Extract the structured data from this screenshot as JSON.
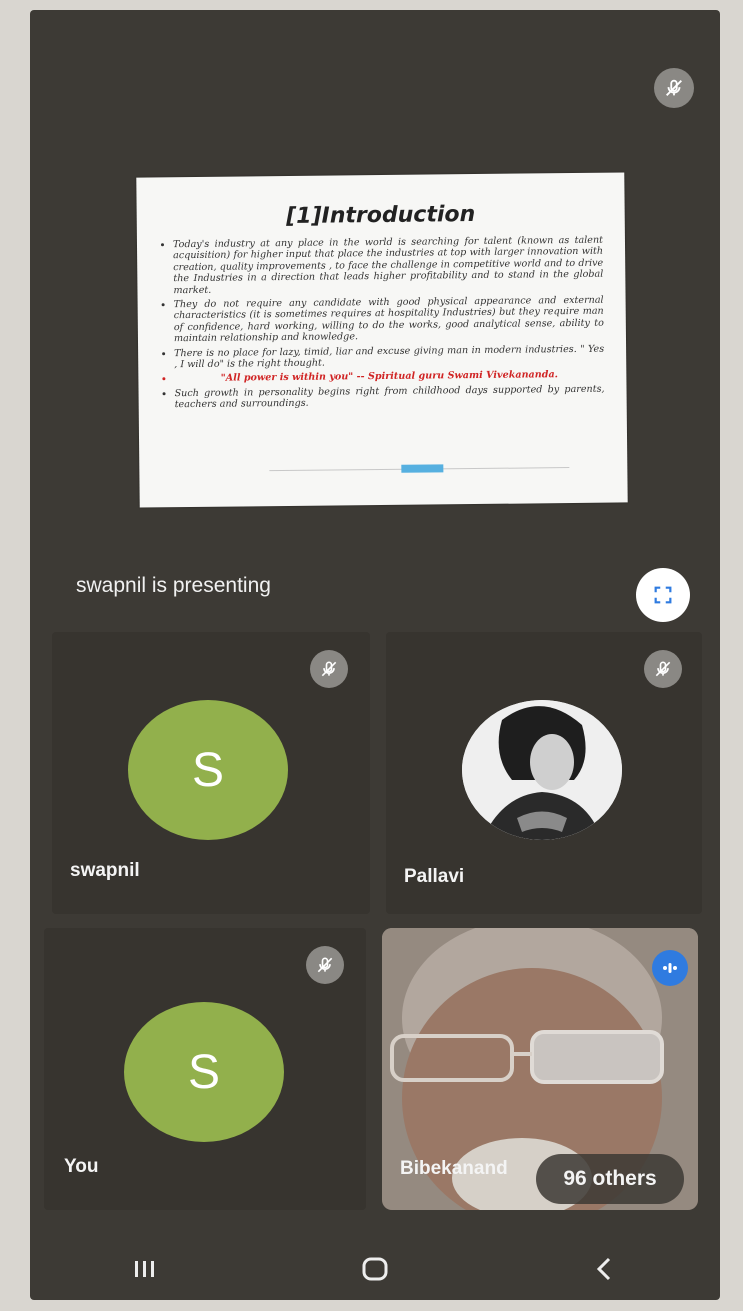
{
  "slide": {
    "title": "[1]Introduction",
    "bullets": [
      "Today's industry at any place in the world is searching for talent (known as talent acquisition) for higher input that place the industries at top with larger innovation with creation, quality improvements , to face the challenge in competitive world and to drive the Industries in a direction that leads higher profitability and to stand in the global market.",
      "They do not require any candidate with good physical appearance and external characteristics (it is sometimes requires at hospitality Industries) but they require man of confidence, hard working, willing to do the works, good analytical sense, ability to maintain relationship and knowledge.",
      "There is no place for lazy, timid, liar and excuse giving man in modern industries. \" Yes , I will do\" is the right thought.",
      "\"All power is within you\" -- Spiritual guru Swami Vivekananda.",
      "Such growth in personality begins right from childhood days supported by parents, teachers and surroundings."
    ]
  },
  "presenting_text": "swapnil is presenting",
  "participants": [
    {
      "name": "swapnil",
      "initial": "S",
      "avatar_color": "#92b04c"
    },
    {
      "name": "Pallavi"
    },
    {
      "name": "You",
      "initial": "S",
      "avatar_color": "#92b04c"
    },
    {
      "name": "Bibekanand"
    }
  ],
  "others_label": "96 others",
  "icons": {
    "muted": "mic-off-icon",
    "fullscreen": "fullscreen-icon",
    "speaking": "audio-level-icon",
    "nav": [
      "recent-apps-icon",
      "home-icon",
      "back-icon"
    ]
  },
  "colors": {
    "background": "#3d3a35",
    "avatar": "#92b04c",
    "speaking": "#2f7be0"
  }
}
